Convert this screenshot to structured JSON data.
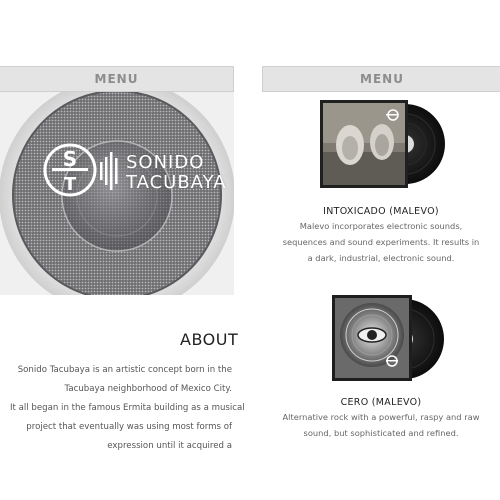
{
  "left": {
    "menu_label": "MENU",
    "logo": {
      "line1": "SONIDO",
      "line2": "TACUBAYA",
      "mark": "ST"
    },
    "about": {
      "title": "ABOUT",
      "lines": [
        "Sonido Tacubaya is an artistic concept born in the",
        "Tacubaya neighborhood of Mexico City.",
        "It all began in the famous Ermita building as a musical",
        "project that eventually was using most forms of",
        "expression until it acquired a"
      ]
    }
  },
  "right": {
    "menu_label": "MENU",
    "albums": [
      {
        "title": "INTOXICADO (MALEVO)",
        "description": [
          "Malevo incorporates electronic sounds,",
          "sequences and sound experiments. It results in",
          "a dark, industrial, electronic sound."
        ],
        "cover_icon": "urinals-photo"
      },
      {
        "title": "CERO (MALEVO)",
        "description": [
          "Alternative rock with a powerful, raspy and raw",
          "sound, but sophisticated and refined."
        ],
        "cover_icon": "eye-photo"
      }
    ]
  },
  "colors": {
    "menu_bg": "#e4e4e4",
    "menu_text": "#8d8d8d",
    "body_text": "#555555"
  }
}
